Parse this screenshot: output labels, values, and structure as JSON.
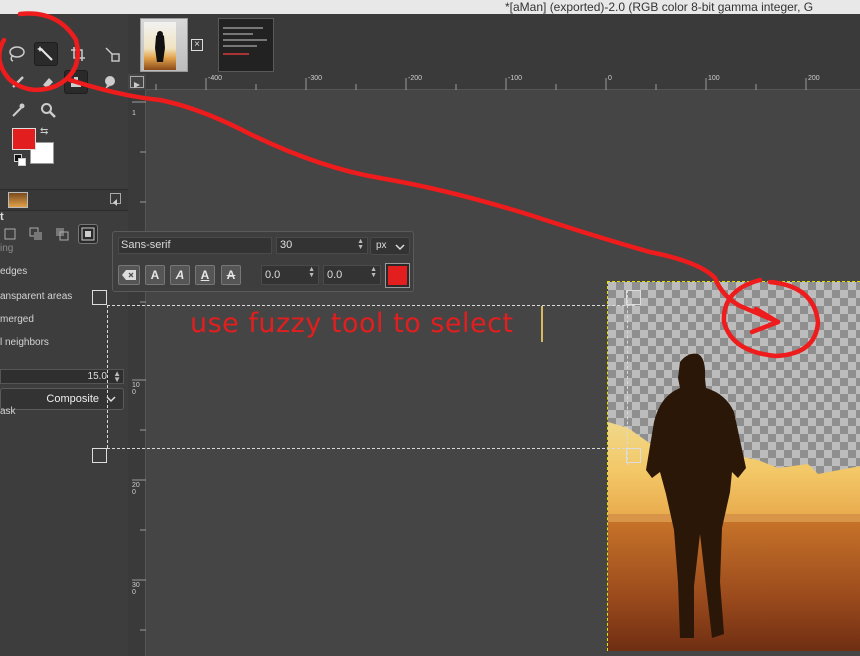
{
  "window": {
    "title": "*[aMan] (exported)-2.0 (RGB color 8-bit gamma integer, G"
  },
  "tool_options": {
    "heading": "t",
    "options": [
      "ing",
      "edges",
      "ansparent areas",
      "merged",
      "l neighbors"
    ],
    "threshold": "15.0",
    "select_by": "Composite",
    "last_option": "ask"
  },
  "text_toolbar": {
    "font": "Sans-serif",
    "size": "30",
    "unit": "px",
    "baseline": "0.0",
    "kerning": "0.0",
    "bold_label": "A",
    "italic_label": "A",
    "underline_label": "A",
    "strike_label": "A",
    "text_color": "#e31e1e"
  },
  "canvas": {
    "text": "use fuzzy tool to select",
    "hruler_labels": [
      "-400",
      "-300",
      "-200",
      "-100",
      "0",
      "100",
      "200"
    ],
    "vruler_labels": [
      "1",
      "100",
      "200",
      "300"
    ]
  },
  "colors": {
    "foreground": "#e31e1e",
    "background": "#ffffff",
    "annotation": "#ee1c1c"
  }
}
